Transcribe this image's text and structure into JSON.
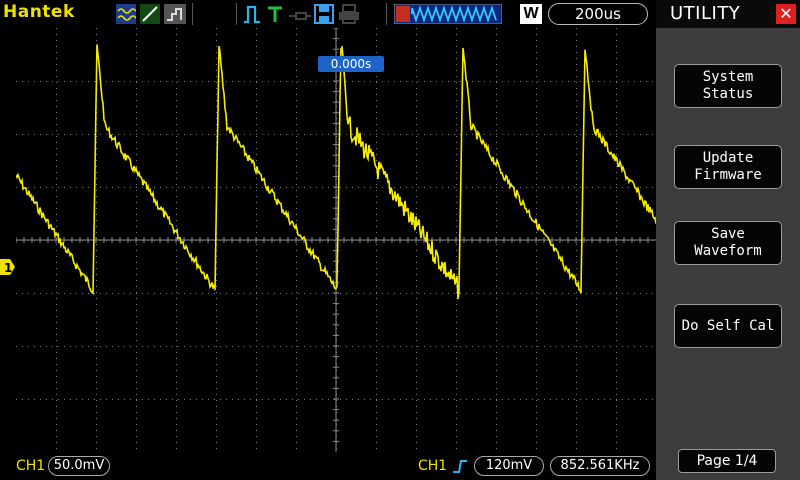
{
  "header": {
    "brand": "Hantek",
    "icons": [
      "waveform-mode-icon",
      "xy-mode-icon",
      "persist-icon",
      "run-stop-icon",
      "trigger-t-icon",
      "probe-icon",
      "save-disk-icon",
      "print-icon",
      "memory-waveform-icon"
    ],
    "window_label": "W",
    "timebase": "200us"
  },
  "screen": {
    "trigger_time": "0.000s",
    "ch1_marker_label": "1",
    "trace_color": "#f5ec00"
  },
  "footer": {
    "ch1_label": "CH1",
    "ch1_scale": "50.0mV",
    "trigger_channel": "CH1",
    "trigger_level": "120mV",
    "frequency": "852.561KHz"
  },
  "menu": {
    "title": "UTILITY",
    "close_glyph": "✕",
    "buttons": [
      {
        "label": "System\nStatus"
      },
      {
        "label": "Update\nFirmware"
      },
      {
        "label": "Save\nWaveform"
      },
      {
        "label": "Do Self Cal"
      }
    ],
    "page": "Page 1/4"
  }
}
